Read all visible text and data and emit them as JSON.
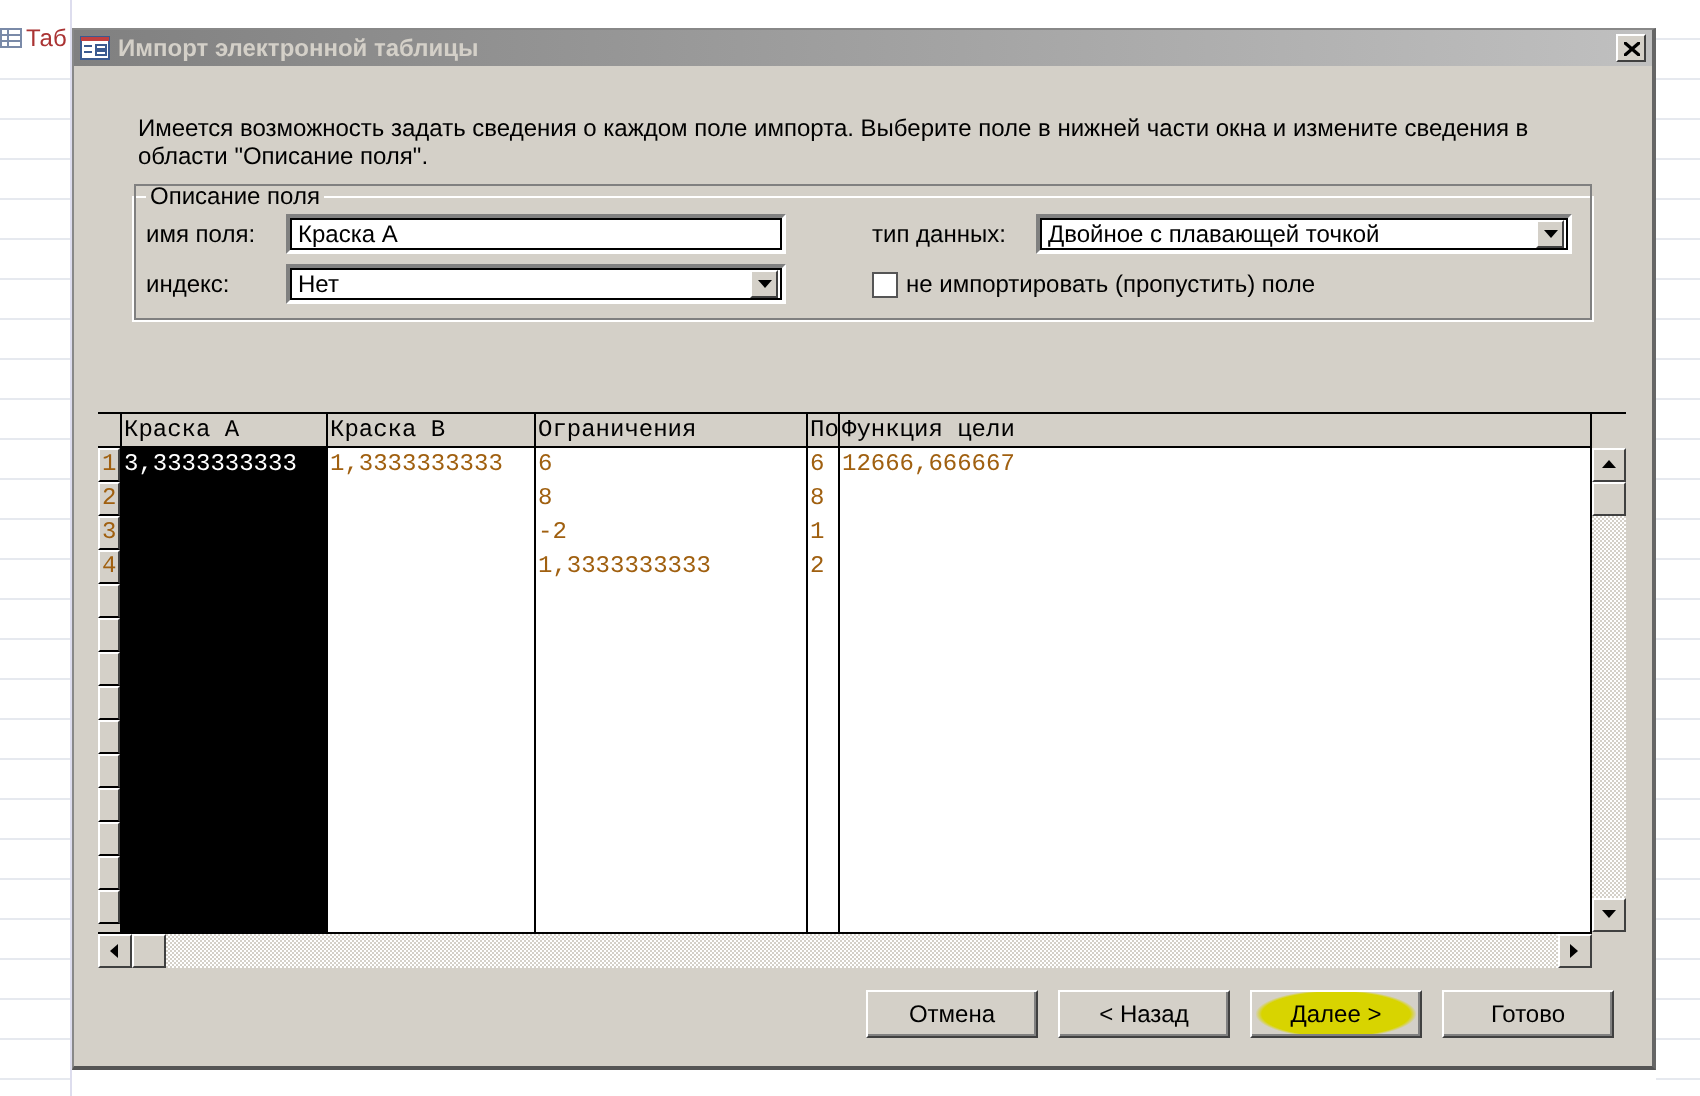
{
  "background_app": {
    "tab_label": "Таб"
  },
  "window": {
    "title": "Импорт электронной таблицы"
  },
  "intro": "Имеется возможность задать сведения о каждом поле импорта. Выберите поле в нижней части окна и измените сведения в области \"Описание поля\".",
  "field_options": {
    "title": "Описание поля",
    "field_name": {
      "label": "имя поля:",
      "value": "Краска А"
    },
    "data_type": {
      "label": "тип данных:",
      "value": "Двойное с плавающей точкой"
    },
    "index": {
      "label": "индекс:",
      "value": "Нет"
    },
    "skip_field": {
      "label": "не импортировать (пропустить) поле",
      "checked": false
    }
  },
  "table": {
    "row_numbers": [
      "1",
      "2",
      "3",
      "4"
    ],
    "columns": [
      {
        "label": "Краска А",
        "selected": true,
        "cells": [
          "3,3333333333"
        ]
      },
      {
        "label": "Краска В",
        "selected": false,
        "cells": [
          "1,3333333333"
        ]
      },
      {
        "label": "Ограничения",
        "selected": false,
        "cells": [
          "6",
          "8",
          "-2",
          "1,3333333333"
        ]
      },
      {
        "label": "По",
        "selected": false,
        "cells": [
          "6",
          "8",
          "1",
          "2"
        ]
      },
      {
        "label": "Функция цели",
        "selected": false,
        "cells": [
          "12666,666667"
        ]
      }
    ]
  },
  "buttons": [
    {
      "label": "Отмена",
      "highlighted": false
    },
    {
      "label": "< Назад",
      "highlighted": false
    },
    {
      "label": "Далее >",
      "highlighted": true
    },
    {
      "label": "Готово",
      "highlighted": false
    }
  ]
}
